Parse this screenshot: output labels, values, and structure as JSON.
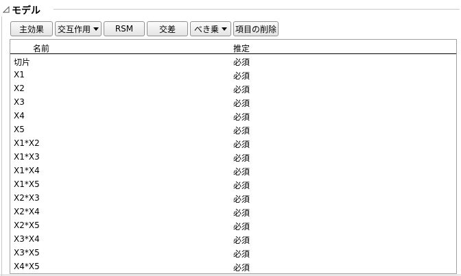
{
  "section": {
    "title": "モデル"
  },
  "toolbar": {
    "main_effects": "主効果",
    "interaction": "交互作用",
    "rsm": "RSM",
    "cross": "交差",
    "power": "べき乗",
    "remove_term": "項目の削除"
  },
  "table": {
    "headers": {
      "name": "名前",
      "estimate": "推定"
    },
    "rows": [
      {
        "name": "切片",
        "estimate": "必須"
      },
      {
        "name": "X1",
        "estimate": "必須"
      },
      {
        "name": "X2",
        "estimate": "必須"
      },
      {
        "name": "X3",
        "estimate": "必須"
      },
      {
        "name": "X4",
        "estimate": "必須"
      },
      {
        "name": "X5",
        "estimate": "必須"
      },
      {
        "name": "X1*X2",
        "estimate": "必須"
      },
      {
        "name": "X1*X3",
        "estimate": "必須"
      },
      {
        "name": "X1*X4",
        "estimate": "必須"
      },
      {
        "name": "X1*X5",
        "estimate": "必須"
      },
      {
        "name": "X2*X3",
        "estimate": "必須"
      },
      {
        "name": "X2*X4",
        "estimate": "必須"
      },
      {
        "name": "X2*X5",
        "estimate": "必須"
      },
      {
        "name": "X3*X4",
        "estimate": "必須"
      },
      {
        "name": "X3*X5",
        "estimate": "必須"
      },
      {
        "name": "X4*X5",
        "estimate": "必須"
      }
    ]
  }
}
